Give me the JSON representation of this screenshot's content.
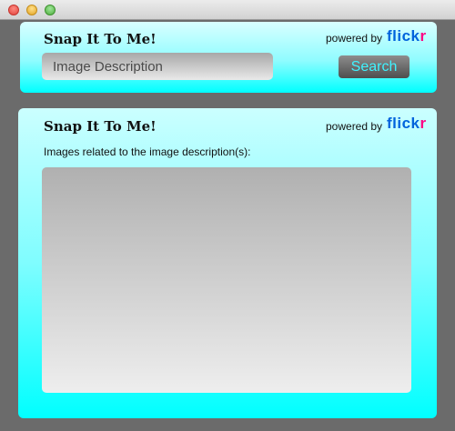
{
  "window": {
    "controls": [
      "close",
      "minimize",
      "zoom"
    ]
  },
  "search_panel": {
    "app_title": "Snap It To Me!",
    "powered_by": "powered by",
    "brand": {
      "part1": "flick",
      "part2": "r"
    },
    "search_input": {
      "value": "",
      "placeholder": "Image Description"
    },
    "search_button_label": "Search"
  },
  "results_panel": {
    "app_title": "Snap It To Me!",
    "powered_by": "powered by",
    "brand": {
      "part1": "flick",
      "part2": "r"
    },
    "related_label": "Images related to the image description(s):"
  },
  "colors": {
    "panel_gradient_top": "#d9ffff",
    "panel_gradient_bottom": "#00ffff",
    "flickr_blue": "#0063dc",
    "flickr_pink": "#ff0084",
    "search_button_text": "#3ff3ff"
  }
}
